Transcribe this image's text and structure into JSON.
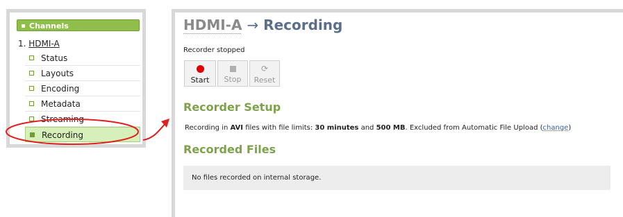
{
  "sidebar": {
    "header": "Channels",
    "channel_number": "1.",
    "channel_name": "HDMI-A",
    "items": [
      {
        "label": "Status"
      },
      {
        "label": "Layouts"
      },
      {
        "label": "Encoding"
      },
      {
        "label": "Metadata"
      },
      {
        "label": "Streaming"
      },
      {
        "label": "Recording"
      }
    ]
  },
  "main": {
    "title_channel": "HDMI-A",
    "title_arrow": "→",
    "title_page": "Recording",
    "status": "Recorder stopped",
    "buttons": {
      "start": "Start",
      "stop": "Stop",
      "reset": "Reset"
    },
    "setup_heading": "Recorder Setup",
    "setup": {
      "p1": "Recording in ",
      "format": "AVI",
      "p2": " files with file limits: ",
      "time_limit": "30 minutes",
      "p3": " and ",
      "size_limit": "500 MB",
      "p4": ". Excluded from Automatic File Upload  (",
      "change_link": "change",
      "p5": ")"
    },
    "files_heading": "Recorded Files",
    "files_empty": "No files recorded on internal storage."
  },
  "colors": {
    "accent_green": "#7ea24a",
    "header_green": "#8fbf4a",
    "active_item_bg": "#d7efb8",
    "record_red": "#e00000",
    "annotation_red": "#e02020"
  }
}
